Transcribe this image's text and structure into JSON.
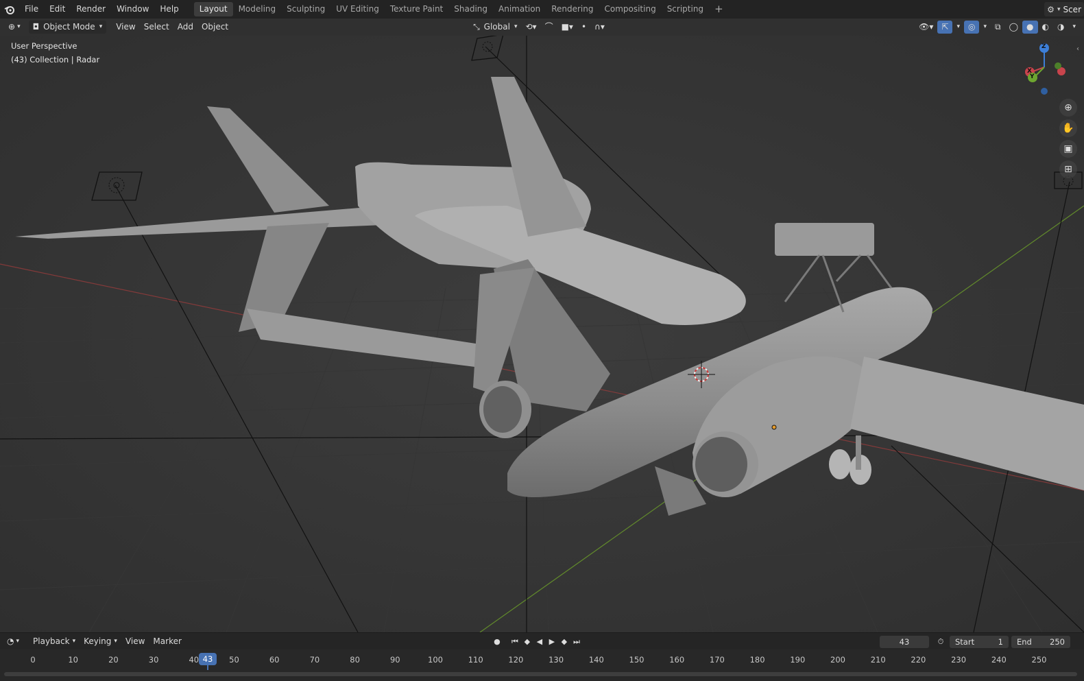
{
  "menu": [
    "File",
    "Edit",
    "Render",
    "Window",
    "Help"
  ],
  "workspace_tabs": [
    "Layout",
    "Modeling",
    "Sculpting",
    "UV Editing",
    "Texture Paint",
    "Shading",
    "Animation",
    "Rendering",
    "Compositing",
    "Scripting"
  ],
  "active_tab": "Layout",
  "scene_label": "Scer",
  "header": {
    "mode": "Object Mode",
    "menus": [
      "View",
      "Select",
      "Add",
      "Object"
    ],
    "orientation": "Global"
  },
  "viewport": {
    "perspective": "User Perspective",
    "collection": "(43) Collection | Radar"
  },
  "gizmo": {
    "x": "X",
    "y": "Y",
    "z": "Z"
  },
  "timeline": {
    "menus": [
      "Playback",
      "Keying",
      "View",
      "Marker"
    ],
    "current_frame": "43",
    "start_label": "Start",
    "start_value": "1",
    "end_label": "End",
    "end_value": "250",
    "ticks": [
      "0",
      "10",
      "20",
      "30",
      "40",
      "50",
      "60",
      "70",
      "80",
      "90",
      "100",
      "110",
      "120",
      "130",
      "140",
      "150",
      "160",
      "170",
      "180",
      "190",
      "200",
      "210",
      "220",
      "230",
      "240",
      "250"
    ]
  },
  "colors": {
    "accent": "#4772b3",
    "x_axis": "#c8444c",
    "y_axis": "#6ea630",
    "z_axis": "#3d7fd8"
  }
}
